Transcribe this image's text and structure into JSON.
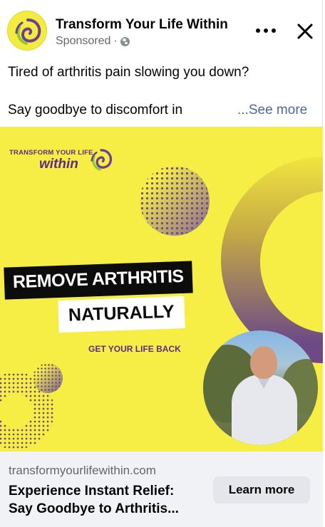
{
  "post": {
    "page_name": "Transform Your Life Within",
    "sponsored_label": "Sponsored",
    "separator": "·",
    "text_line1": "Tired of arthritis pain slowing you down?",
    "text_line2": "Say goodbye to discomfort in",
    "see_more": "...See more"
  },
  "creative": {
    "brand_top": "TRANSFORM YOUR LIFE",
    "brand_bottom": "within",
    "headline_line1": "REMOVE ARTHRITIS",
    "headline_line2": "NATURALLY",
    "tagline": "GET YOUR LIFE BACK"
  },
  "footer": {
    "domain": "transformyourlifewithin.com",
    "headline_line1": "Experience Instant Relief:",
    "headline_line2": "Say Goodbye to Arthritis...",
    "cta_label": "Learn more"
  },
  "colors": {
    "brand_yellow": "#f6ee45",
    "brand_purple": "#5b2d84",
    "link_gray_blue": "#4b6b9b",
    "secondary_text": "#65676b"
  },
  "icons": [
    "globe-icon",
    "more-options-icon",
    "close-icon",
    "brand-swirl-icon"
  ]
}
